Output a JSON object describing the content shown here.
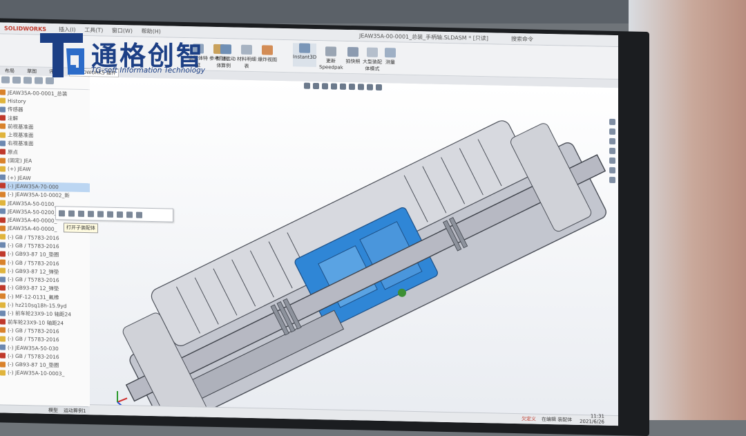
{
  "window": {
    "app_name": "SOLIDWORKS",
    "menu": [
      "插入(I)",
      "工具(T)",
      "窗口(W)",
      "帮助(H)"
    ],
    "document_title": "JEAW35A-00-0001_总装_手柄轴.SLDASM * [只读]",
    "search_placeholder": "搜索命令"
  },
  "ribbon": {
    "buttons": [
      {
        "label": "装配体特征"
      },
      {
        "label": "参考几何体"
      },
      {
        "label": "新建运动算例"
      },
      {
        "label": "材料明细表"
      },
      {
        "label": "爆炸视图"
      },
      {
        "label": "Instant3D"
      },
      {
        "label": "更新Speedpak"
      },
      {
        "label": "拍快照"
      },
      {
        "label": "大型装配体模式"
      },
      {
        "label": "测量"
      }
    ]
  },
  "command_tabs": [
    "布局",
    "草图",
    "评估",
    "SOLIDWORKS 插件"
  ],
  "feature_tree": {
    "rows": [
      {
        "text": "JEAW35A-00-0001_总装",
        "selected": false
      },
      {
        "text": "History",
        "selected": false
      },
      {
        "text": "传感器",
        "selected": false
      },
      {
        "text": "注解",
        "selected": false
      },
      {
        "text": "前视基准面",
        "selected": false
      },
      {
        "text": "上视基准面",
        "selected": false
      },
      {
        "text": "右视基准面",
        "selected": false
      },
      {
        "text": "原点",
        "selected": false
      },
      {
        "text": "(固定) JEA",
        "selected": false
      },
      {
        "text": "(+) JEAW",
        "selected": false
      },
      {
        "text": "(+) JEAW",
        "selected": false
      },
      {
        "text": "(-) JEAW35A-70-000",
        "selected": true
      },
      {
        "text": "(-) JEAW35A-10-0002_新",
        "selected": false
      },
      {
        "text": "JEAW35A-50-0100_",
        "selected": false
      },
      {
        "text": "JEAW35A-50-0200_",
        "selected": false
      },
      {
        "text": "JEAW35A-40-0000_",
        "selected": false
      },
      {
        "text": "JEAW35A-40-0000_",
        "selected": false
      },
      {
        "text": "(-) GB / T5783-2016",
        "selected": false
      },
      {
        "text": "(-) GB / T5783-2016",
        "selected": false
      },
      {
        "text": "(-) GB93-87 10_垫圈",
        "selected": false
      },
      {
        "text": "(-) GB / T5783-2016",
        "selected": false
      },
      {
        "text": "(-) GB93-87 12_弹垫",
        "selected": false
      },
      {
        "text": "(-) GB / T5783-2016",
        "selected": false
      },
      {
        "text": "(-) GB93-87 12_弹垫",
        "selected": false
      },
      {
        "text": "(-) MF-12-0131_氟橡",
        "selected": false
      },
      {
        "text": "(-) hz210sq18h-15.9yd",
        "selected": false
      },
      {
        "text": "(-) 前车轮23X9-10 轴距24",
        "selected": false
      },
      {
        "text": "前车轮23X9-10 轴距24",
        "selected": false
      },
      {
        "text": "(-) GB / T5783-2016",
        "selected": false
      },
      {
        "text": "(-) GB / T5783-2016",
        "selected": false
      },
      {
        "text": "(-) JEAW35A-50-030",
        "selected": false
      },
      {
        "text": "(-) GB / T5783-2016",
        "selected": false
      },
      {
        "text": "(-) GB93-87 10_垫圈",
        "selected": false
      },
      {
        "text": "(-) JEAW35A-10-0003_",
        "selected": false
      }
    ]
  },
  "context_popup": {
    "tooltip": "打开子装配体"
  },
  "bottom_tabs": [
    "模型",
    "运动算例1"
  ],
  "status_bar": {
    "doc_state": "欠定义",
    "units": "在编辑 装配体"
  },
  "clock": {
    "time": "11:31",
    "date": "2021/6/26"
  },
  "watermark": {
    "title": "通格创智",
    "subtitle": "TG-soft Information Technology",
    "mark": "TG"
  },
  "colors": {
    "accent": "#1c3f85",
    "part_blue": "#2f86d6",
    "part_grey": "#b9bcc6"
  }
}
